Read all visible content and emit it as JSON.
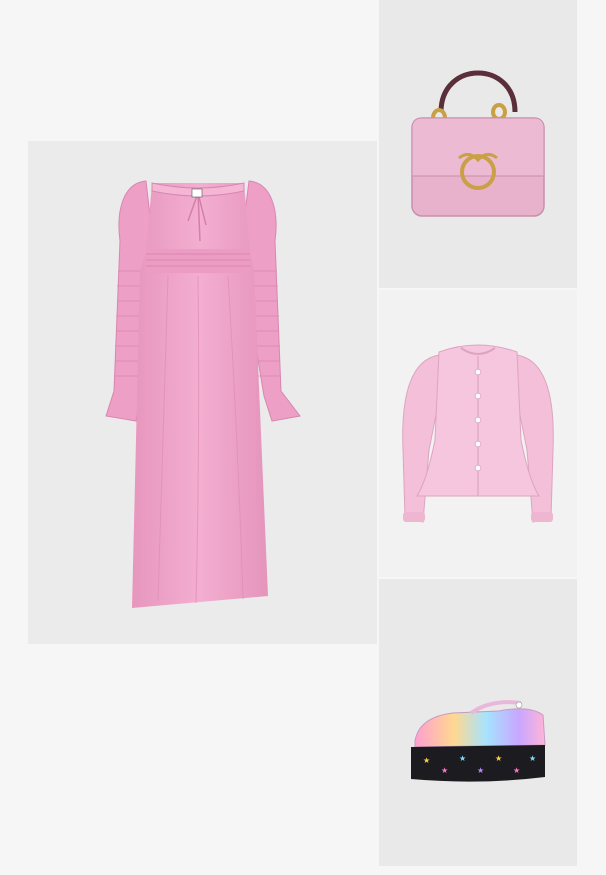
{
  "outfit": {
    "items": [
      {
        "id": "dress",
        "kind": "smocked long-sleeve maxi dress",
        "color": "#f0a6c9"
      },
      {
        "id": "bag",
        "kind": "top-handle leather bag with gold chain",
        "color": "#e9b2cc"
      },
      {
        "id": "cardigan",
        "kind": "puff-sleeve peplum cardigan",
        "color": "#f4bfd9"
      },
      {
        "id": "shoe",
        "kind": "rainbow star platform mary jane",
        "color": "#1c1b1f"
      }
    ]
  },
  "colors": {
    "page_bg": "#f6f6f6",
    "tile_bg": "#ebebeb",
    "dress_pink": "#f0a6c9",
    "bag_pink": "#e9b2cc",
    "gold": "#c9a046",
    "cardigan_pink": "#f4bfd9"
  }
}
